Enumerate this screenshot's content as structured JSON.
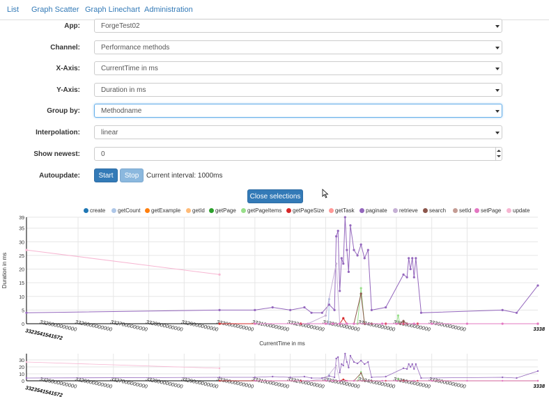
{
  "nav": {
    "items": [
      {
        "label": "List"
      },
      {
        "label": "Graph Scatter"
      },
      {
        "label": "Graph Linechart"
      },
      {
        "label": "Administration"
      }
    ]
  },
  "form": {
    "app": {
      "label": "App:",
      "value": "ForgeTest02"
    },
    "channel": {
      "label": "Channel:",
      "value": "Performance methods"
    },
    "xaxis": {
      "label": "X-Axis:",
      "value": "CurrentTime in ms"
    },
    "yaxis": {
      "label": "Y-Axis:",
      "value": "Duration in ms"
    },
    "groupby": {
      "label": "Group by:",
      "value": "Methodname"
    },
    "interpolation": {
      "label": "Interpolation:",
      "value": "linear"
    },
    "shownewest": {
      "label": "Show newest:",
      "value": "0"
    },
    "autoupdate": {
      "label": "Autoupdate:",
      "start_label": "Start",
      "stop_label": "Stop",
      "interval_text": "Current interval: 1000ms"
    }
  },
  "close_selections_label": "Close selections",
  "colors": {
    "accent": "#337ab7",
    "accent_light": "#8bb8de"
  },
  "chart_data": [
    {
      "type": "line",
      "xlabel": "CurrentTime in ms",
      "ylabel": "Duration in ms",
      "ylim": [
        0,
        39
      ],
      "xlim": [
        3323541541572,
        3338000000000
      ],
      "yticks": [
        0,
        5,
        10,
        15,
        20,
        25,
        30,
        35,
        39
      ],
      "xticks": [
        3325000000000,
        3326000000000,
        3327000000000,
        3328000000000,
        3329000000000,
        3330000000000,
        3331000000000,
        3332000000000,
        3333000000000,
        3334000000000,
        3335000000000,
        3336000000000
      ],
      "xtick_labels": [
        "3325000000000",
        "3326000000000",
        "3327000000000",
        "3328000000000",
        "3329000000000",
        "3330000000000",
        "3331000000000",
        "3332000000000",
        "3333000000000",
        "3334000000000",
        "3335000000000",
        "3336000000000"
      ],
      "x_edge_labels": [
        "3323541541572",
        "3338"
      ],
      "grid": true,
      "legend_position": "top",
      "series": [
        {
          "name": "create",
          "color": "#1f77b4",
          "points": []
        },
        {
          "name": "getCount",
          "color": "#aec7e8",
          "points": [
            [
              3332080000000,
              0
            ],
            [
              3332100000000,
              9
            ]
          ]
        },
        {
          "name": "getExample",
          "color": "#ff7f0e",
          "points": []
        },
        {
          "name": "getId",
          "color": "#ffbb78",
          "points": []
        },
        {
          "name": "getPage",
          "color": "#2ca02c",
          "points": []
        },
        {
          "name": "getPageItems",
          "color": "#98df8a",
          "points": [
            [
              3332900000000,
              0
            ],
            [
              3333000000000,
              13
            ],
            [
              3333100000000,
              0
            ],
            [
              3334000000000,
              0
            ],
            [
              3334050000000,
              3
            ],
            [
              3334100000000,
              0
            ]
          ]
        },
        {
          "name": "getPageSize",
          "color": "#d62728",
          "points": [
            [
              3329000000000,
              0
            ],
            [
              3331300000000,
              0
            ],
            [
              3332400000000,
              0
            ],
            [
              3332500000000,
              2
            ],
            [
              3332600000000,
              0
            ],
            [
              3333700000000,
              0
            ],
            [
              3334200000000,
              0
            ],
            [
              3334600000000,
              0
            ],
            [
              3338000000000,
              0
            ]
          ]
        },
        {
          "name": "getTask",
          "color": "#ff9896",
          "points": []
        },
        {
          "name": "paginate",
          "color": "#9467bd",
          "points": [
            [
              3323541541572,
              4
            ],
            [
              3329000000000,
              5
            ],
            [
              3330000000000,
              5
            ],
            [
              3330500000000,
              6
            ],
            [
              3331000000000,
              5
            ],
            [
              3331400000000,
              6
            ],
            [
              3331600000000,
              4
            ],
            [
              3331900000000,
              4
            ],
            [
              3332100000000,
              7
            ],
            [
              3332250000000,
              5
            ],
            [
              3332300000000,
              32
            ],
            [
              3332350000000,
              34
            ],
            [
              3332400000000,
              12
            ],
            [
              3332450000000,
              24
            ],
            [
              3332500000000,
              22
            ],
            [
              3332550000000,
              39
            ],
            [
              3332600000000,
              27
            ],
            [
              3332650000000,
              19
            ],
            [
              3332700000000,
              36
            ],
            [
              3332800000000,
              27
            ],
            [
              3332900000000,
              25
            ],
            [
              3333000000000,
              29
            ],
            [
              3333100000000,
              24
            ],
            [
              3333200000000,
              27
            ],
            [
              3333300000000,
              5
            ],
            [
              3333700000000,
              6
            ],
            [
              3334200000000,
              18
            ],
            [
              3334300000000,
              17
            ],
            [
              3334350000000,
              24
            ],
            [
              3334400000000,
              20
            ],
            [
              3334450000000,
              24
            ],
            [
              3334500000000,
              17
            ],
            [
              3334550000000,
              24
            ],
            [
              3334700000000,
              4
            ],
            [
              3337000000000,
              5
            ],
            [
              3337400000000,
              4
            ],
            [
              3338000000000,
              14
            ]
          ]
        },
        {
          "name": "retrieve",
          "color": "#c5b0d5",
          "points": [
            [
              3331500000000,
              0
            ],
            [
              3332000000000,
              3
            ],
            [
              3332300000000,
              22
            ],
            [
              3332400000000,
              0
            ]
          ]
        },
        {
          "name": "search",
          "color": "#8c564b",
          "points": [
            [
              3332800000000,
              0
            ],
            [
              3333000000000,
              11
            ],
            [
              3333100000000,
              0
            ],
            [
              3333300000000,
              0
            ],
            [
              3334100000000,
              0
            ],
            [
              3334200000000,
              1
            ],
            [
              3334300000000,
              0
            ]
          ]
        },
        {
          "name": "setId",
          "color": "#c49c94",
          "points": []
        },
        {
          "name": "setPage",
          "color": "#e377c2",
          "points": [
            [
              3330000000000,
              0
            ],
            [
              3332000000000,
              0
            ],
            [
              3332200000000,
              0
            ],
            [
              3332400000000,
              0
            ],
            [
              3332600000000,
              0
            ],
            [
              3332800000000,
              0
            ],
            [
              3333600000000,
              0
            ],
            [
              3334000000000,
              0
            ],
            [
              3334500000000,
              0
            ],
            [
              3335000000000,
              0
            ],
            [
              3336000000000,
              0
            ],
            [
              3337000000000,
              0
            ],
            [
              3338000000000,
              0
            ]
          ]
        },
        {
          "name": "update",
          "color": "#f7b6d2",
          "points": [
            [
              3323541541572,
              27
            ],
            [
              3329000000000,
              18
            ]
          ]
        }
      ]
    },
    {
      "type": "line",
      "ylim": [
        0,
        39
      ],
      "yticks": [
        0,
        10,
        20,
        30
      ],
      "xlim": [
        3323541541572,
        3338000000000
      ],
      "xticks": [
        3325000000000,
        3326000000000,
        3327000000000,
        3328000000000,
        3329000000000,
        3330000000000,
        3331000000000,
        3332000000000,
        3333000000000,
        3334000000000,
        3335000000000,
        3336000000000
      ],
      "xtick_labels": [
        "3325000000000",
        "3326000000000",
        "3327000000000",
        "3328000000000",
        "3329000000000",
        "3330000000000",
        "3331000000000",
        "3332000000000",
        "3333000000000",
        "3334000000000",
        "3335000000000",
        "3336000000000"
      ],
      "x_edge_labels": [
        "3323541541572",
        "3338"
      ],
      "grid": true
    }
  ]
}
